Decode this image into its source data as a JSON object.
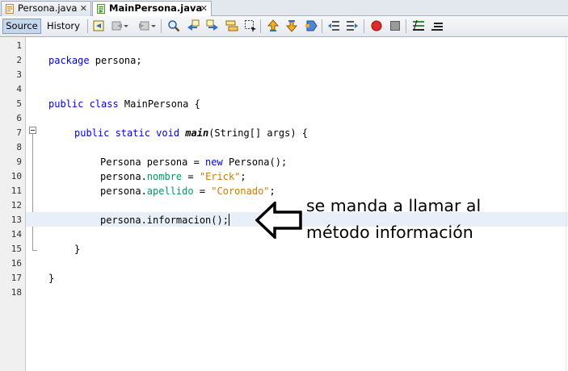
{
  "tabs": [
    {
      "label": "Persona.java",
      "active": false
    },
    {
      "label": "MainPersona.java",
      "active": true
    }
  ],
  "tab_close_glyph": "✕",
  "toolbar": {
    "source_label": "Source",
    "history_label": "History",
    "icons": [
      "last-edit-icon",
      "back-icon",
      "forward-icon",
      "find-icon",
      "find-previous-icon",
      "find-next-icon",
      "toggle-highlight-icon",
      "find-selection-icon",
      "previous-bookmark-icon",
      "next-bookmark-icon",
      "toggle-bookmark-icon",
      "shift-left-icon",
      "shift-right-icon",
      "start-macro-icon",
      "stop-macro-icon",
      "comment-icon",
      "uncomment-icon"
    ]
  },
  "line_numbers": [
    "1",
    "2",
    "3",
    "4",
    "5",
    "6",
    "7",
    "8",
    "9",
    "10",
    "11",
    "12",
    "13",
    "14",
    "15",
    "16",
    "17",
    "18"
  ],
  "code": {
    "l2": {
      "kw": "package",
      "rest": " persona;"
    },
    "l5": {
      "kw": "public class",
      "name": " MainPersona ",
      "rest": "{"
    },
    "l7": {
      "kw": "public static void",
      "method": "main",
      "rest": "(String[] args) {"
    },
    "l9": {
      "pre": "Persona persona = ",
      "kw": "new",
      "rest": " Persona();"
    },
    "l10": {
      "obj": "persona.",
      "field": "nombre",
      "eq": " = ",
      "str": "\"Erick\"",
      "end": ";"
    },
    "l11": {
      "obj": "persona.",
      "field": "apellido",
      "eq": " = ",
      "str": "\"Coronado\"",
      "end": ";"
    },
    "l13": {
      "text": "persona.informacion();"
    },
    "l15": {
      "text": "}"
    },
    "l17": {
      "text": "}"
    }
  },
  "annotation": {
    "line1": "se manda a llamar al",
    "line2": "método información"
  },
  "colors": {
    "keyword": "#0000e6",
    "field": "#009966",
    "string": "#ce7b00",
    "current_line": "#e9eff8"
  }
}
